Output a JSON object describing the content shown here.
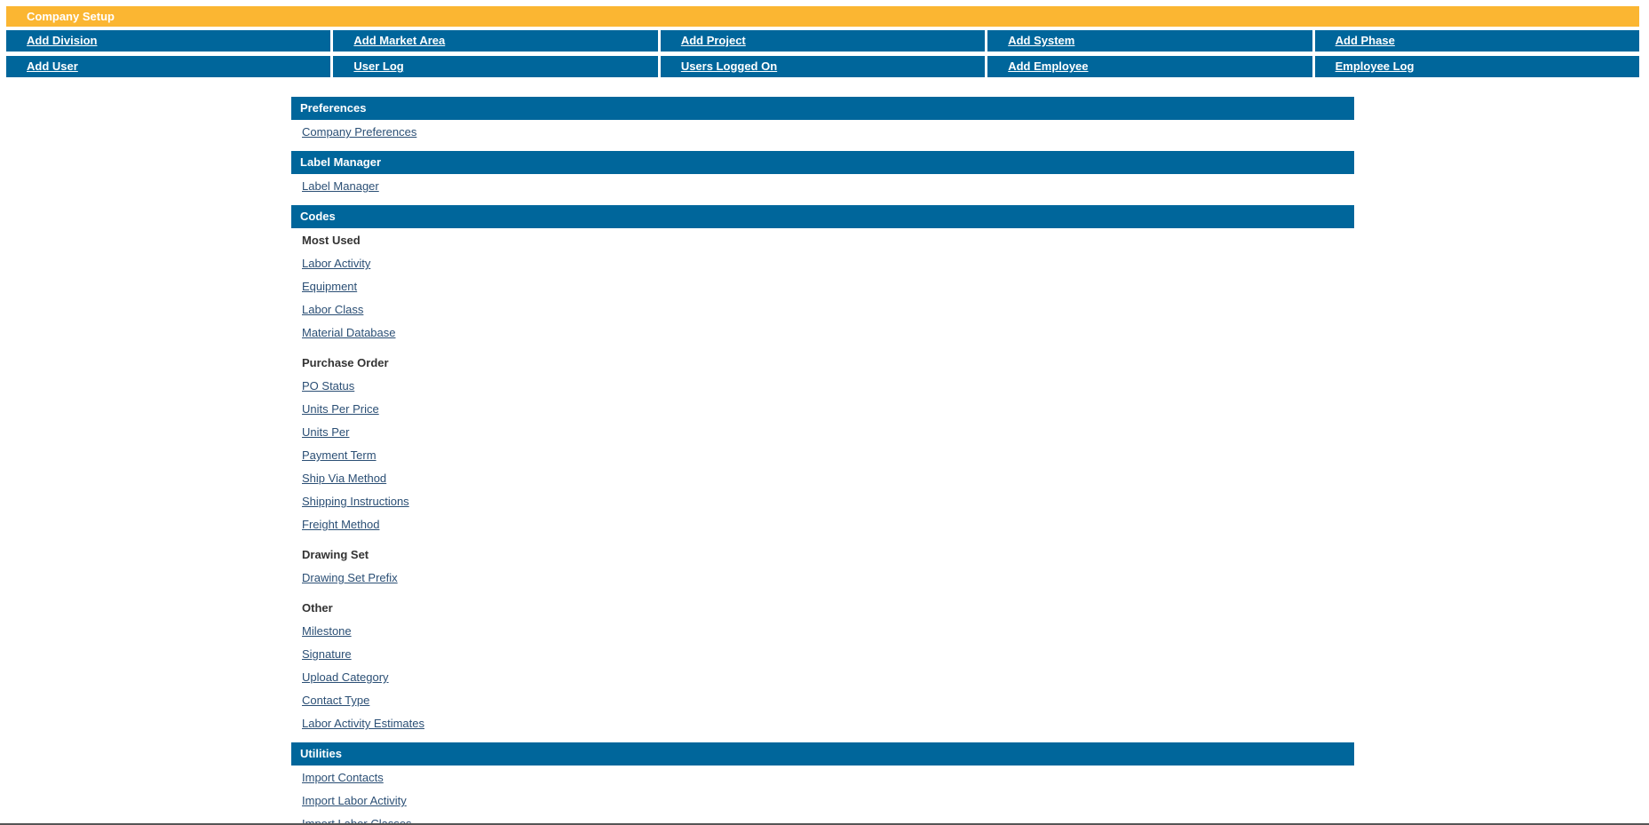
{
  "title_bar": {
    "label": "Company Setup"
  },
  "nav": {
    "row1": [
      {
        "label": "Add Division"
      },
      {
        "label": "Add Market Area"
      },
      {
        "label": "Add Project"
      },
      {
        "label": "Add System"
      },
      {
        "label": "Add Phase"
      }
    ],
    "row2": [
      {
        "label": "Add User"
      },
      {
        "label": "User Log"
      },
      {
        "label": "Users Logged On"
      },
      {
        "label": "Add Employee"
      },
      {
        "label": "Employee Log"
      }
    ]
  },
  "sections": {
    "preferences": {
      "title": "Preferences",
      "links": [
        "Company Preferences"
      ]
    },
    "label_manager": {
      "title": "Label Manager",
      "links": [
        "Label Manager"
      ]
    },
    "codes": {
      "title": "Codes",
      "most_used": {
        "title": "Most Used",
        "links": [
          "Labor Activity",
          "Equipment",
          "Labor Class",
          "Material Database"
        ]
      },
      "purchase_order": {
        "title": "Purchase Order",
        "links": [
          "PO Status",
          "Units Per Price",
          "Units Per",
          "Payment Term",
          "Ship Via Method",
          "Shipping Instructions",
          "Freight Method"
        ]
      },
      "drawing_set": {
        "title": "Drawing Set",
        "links": [
          "Drawing Set Prefix"
        ]
      },
      "other": {
        "title": "Other",
        "links": [
          "Milestone",
          "Signature",
          "Upload Category",
          "Contact Type",
          "Labor Activity Estimates"
        ]
      }
    },
    "utilities": {
      "title": "Utilities",
      "links": [
        "Import Contacts",
        "Import Labor Activity",
        "Import Labor Classes"
      ]
    }
  },
  "colors": {
    "title_bar": "#fbb632",
    "header_blue": "#00669b",
    "link": "#2b4f75"
  }
}
